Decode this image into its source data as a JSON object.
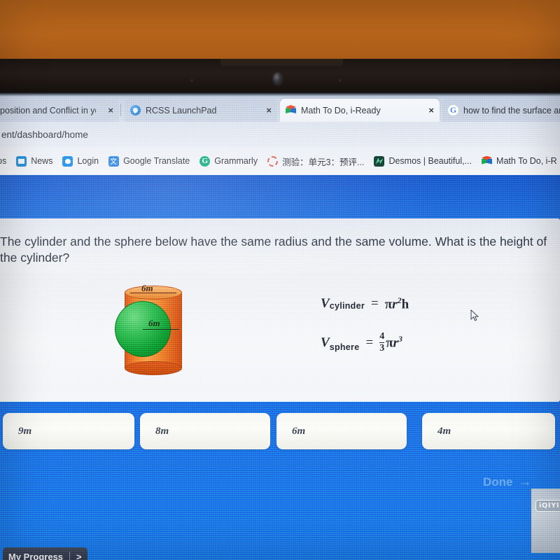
{
  "browser": {
    "tabs": [
      {
        "title": "position and Conflict in your",
        "icon": "none-icon",
        "close": "×",
        "active": false
      },
      {
        "title": "RCSS LaunchPad",
        "icon": "launchpad-icon",
        "close": "×",
        "active": false
      },
      {
        "title": "Math To Do, i-Ready",
        "icon": "iready-cube-icon",
        "close": "×",
        "active": true
      },
      {
        "title": "how to find the surface ar",
        "icon": "google-g-icon",
        "close": "",
        "active": false
      }
    ],
    "url": "ent/dashboard/home",
    "bookmarks": [
      {
        "label": "ps",
        "icon": "apps-icon"
      },
      {
        "label": "News",
        "icon": "news-icon"
      },
      {
        "label": "Login",
        "icon": "login-icon"
      },
      {
        "label": "Google Translate",
        "icon": "google-translate-icon"
      },
      {
        "label": "Grammarly",
        "icon": "grammarly-icon",
        "glyph": "G"
      },
      {
        "label": "测验：单元3：预评...",
        "icon": "loading-dashed-icon"
      },
      {
        "label": "Desmos | Beautiful,...",
        "icon": "desmos-icon"
      },
      {
        "label": "Math To Do, i-R",
        "icon": "iready-cube-icon"
      }
    ]
  },
  "question": {
    "text": "The cylinder and the sphere below have the same radius and the same volume. What is the height of the cylinder?",
    "cylinder_label": "6m",
    "sphere_label": "6m",
    "formulas": {
      "cylinder": {
        "v": "V",
        "sub": "cylinder",
        "eq": "=",
        "pi": "π",
        "r": "r",
        "rexp": "2",
        "h": "h"
      },
      "sphere": {
        "v": "V",
        "sub": "sphere",
        "eq": "=",
        "num": "4",
        "den": "3",
        "pi": "π",
        "r": "r",
        "rexp": "3"
      }
    }
  },
  "answers": [
    {
      "label": "9m"
    },
    {
      "label": "8m"
    },
    {
      "label": "6m"
    },
    {
      "label": "4m"
    }
  ],
  "footer": {
    "done_label": "Done",
    "done_arrow": "→",
    "progress_label": "My Progress",
    "progress_arrow": ">"
  },
  "overlay": {
    "iqiyi_label": "iQIYI"
  },
  "colors": {
    "app_blue": "#1a73e8",
    "header_blue": "#1a55c9",
    "cylinder_orange": "#ef7c2c",
    "sphere_green": "#1aa24a",
    "card_bg": "#f3f5f8"
  }
}
